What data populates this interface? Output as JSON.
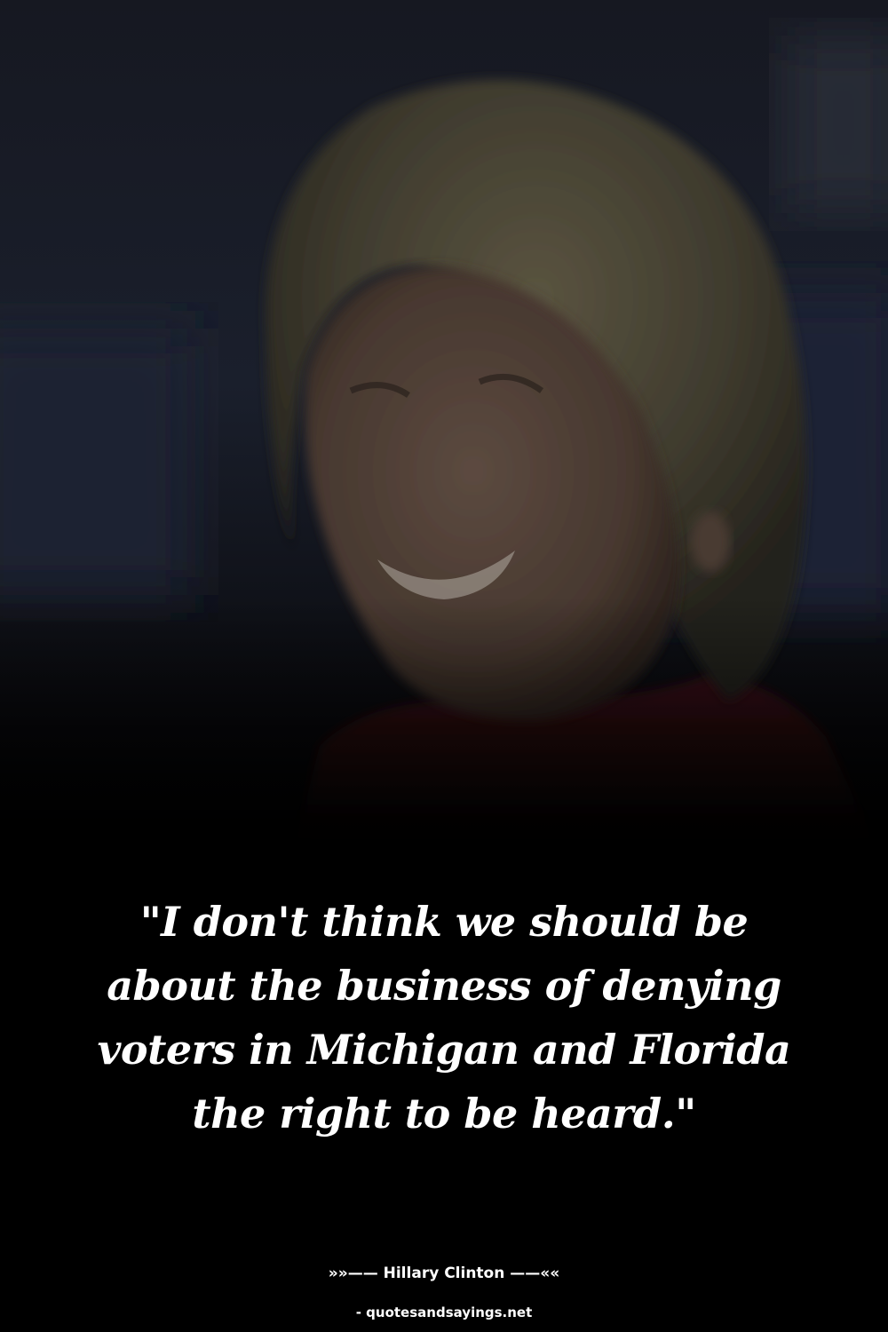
{
  "quote": {
    "text": "\"I don't think we should be about the business of denying voters in Michigan and Florida the right to be heard.\""
  },
  "attribution": {
    "author_line": "»»—— Hillary Clinton ——««"
  },
  "footer": {
    "source": "- quotesandsayings.net"
  },
  "colors": {
    "background": "#000000",
    "text": "#ffffff",
    "backdrop_blue": "#1c2231",
    "jacket_red": "#2a0e10"
  },
  "photo": {
    "subject": "smiling-woman-portrait"
  }
}
